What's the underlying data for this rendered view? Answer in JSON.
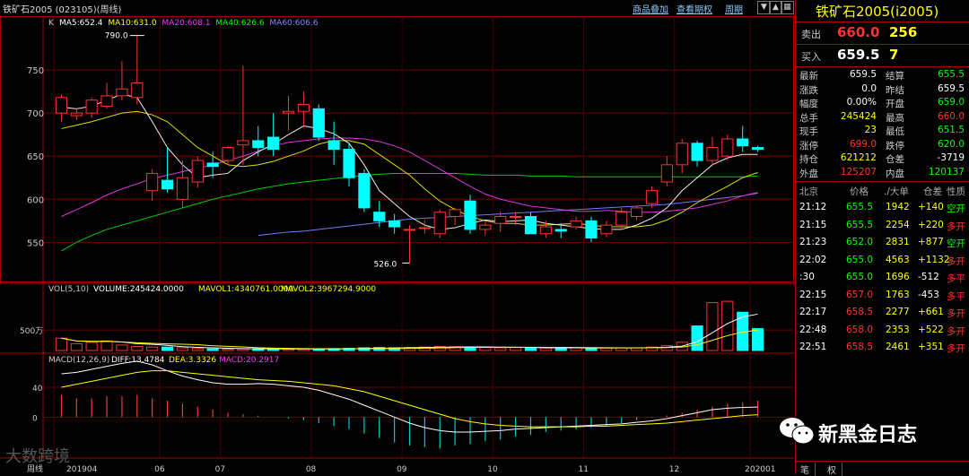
{
  "window": {
    "title": "铁矿石2005 (023105)(周线)",
    "buttons": [
      "商品叠加",
      "查看期权",
      "周期"
    ],
    "icons": [
      "down-arrow-icon",
      "up-arrow-icon",
      "grid-icon"
    ]
  },
  "main_legend": {
    "k": "K",
    "ma5": "MA5:652.4",
    "ma10": "MA10:631.0",
    "ma20": "MA20:608.1",
    "ma40": "MA40:626.6",
    "ma60": "MA60:606.6",
    "colors": {
      "ma5": "#ffffff",
      "ma10": "#ffff00",
      "ma20": "#ff33ff",
      "ma40": "#00ff00",
      "ma60": "#6666ff"
    }
  },
  "vol_legend": {
    "name": "VOL(5,10)",
    "volume": "VOLUME:245424.0000",
    "mavol1": "MAVOL1:4340761.0000",
    "mavol2": "MAVOL2:3967294.9000",
    "y_label": "500万"
  },
  "macd_legend": {
    "name": "MACD(12,26,9)",
    "diff": "DIFF:13.4784",
    "dea": "DEA:3.3326",
    "macd": "MACD:20.2917",
    "y_labels": [
      "40",
      "0"
    ]
  },
  "price_axis": [
    "750",
    "700",
    "650",
    "600",
    "550"
  ],
  "annotations": {
    "high": "790.0",
    "low": "526.0"
  },
  "x_axis": {
    "period_label": "周线",
    "labels": [
      "201904",
      "06",
      "07",
      "08",
      "09",
      "10",
      "11",
      "12",
      "202001"
    ]
  },
  "chart_data": {
    "type": "candlestick",
    "ylim": [
      515,
      800
    ],
    "candles": [
      [
        700,
        718,
        690,
        722
      ],
      [
        697,
        700,
        692,
        705
      ],
      [
        700,
        715,
        695,
        718
      ],
      [
        708,
        720,
        705,
        735
      ],
      [
        720,
        728,
        715,
        760
      ],
      [
        718,
        735,
        710,
        790
      ],
      [
        610,
        630,
        598,
        635
      ],
      [
        622,
        612,
        608,
        660
      ],
      [
        600,
        625,
        590,
        645
      ],
      [
        620,
        645,
        613,
        650
      ],
      [
        642,
        638,
        625,
        655
      ],
      [
        645,
        660,
        640,
        662
      ],
      [
        663,
        668,
        640,
        755
      ],
      [
        668,
        660,
        650,
        685
      ],
      [
        672,
        658,
        650,
        700
      ],
      [
        700,
        702,
        680,
        720
      ],
      [
        702,
        710,
        685,
        725
      ],
      [
        705,
        672,
        668,
        710
      ],
      [
        668,
        658,
        640,
        690
      ],
      [
        658,
        625,
        615,
        665
      ],
      [
        630,
        590,
        585,
        635
      ],
      [
        585,
        575,
        568,
        598
      ],
      [
        575,
        568,
        560,
        583
      ],
      [
        565,
        565,
        526,
        570
      ],
      [
        566,
        567,
        560,
        575
      ],
      [
        560,
        585,
        555,
        588
      ],
      [
        580,
        588,
        570,
        590
      ],
      [
        598,
        565,
        560,
        605
      ],
      [
        565,
        570,
        558,
        574
      ],
      [
        572,
        580,
        562,
        586
      ],
      [
        580,
        580,
        570,
        585
      ],
      [
        580,
        560,
        560,
        585
      ],
      [
        560,
        568,
        555,
        575
      ],
      [
        565,
        563,
        555,
        572
      ],
      [
        568,
        575,
        565,
        580
      ],
      [
        575,
        555,
        550,
        580
      ],
      [
        560,
        570,
        556,
        575
      ],
      [
        570,
        585,
        565,
        590
      ],
      [
        580,
        590,
        576,
        592
      ],
      [
        595,
        610,
        590,
        615
      ],
      [
        620,
        640,
        615,
        650
      ],
      [
        640,
        665,
        630,
        670
      ],
      [
        665,
        645,
        638,
        668
      ],
      [
        645,
        660,
        640,
        672
      ],
      [
        650,
        670,
        645,
        675
      ],
      [
        670,
        662,
        655,
        685
      ],
      [
        660,
        658,
        655,
        662
      ]
    ],
    "ma_series": {
      "ma5": [
        707,
        705,
        708,
        715,
        722,
        718,
        690,
        660,
        640,
        625,
        628,
        630,
        645,
        655,
        664,
        675,
        685,
        682,
        676,
        665,
        640,
        610,
        595,
        580,
        570,
        565,
        567,
        572,
        576,
        574,
        575,
        576,
        572,
        570,
        568,
        566,
        565,
        565,
        570,
        578,
        590,
        610,
        625,
        640,
        648,
        652,
        652
      ],
      "ma10": [
        682,
        686,
        690,
        695,
        700,
        702,
        698,
        690,
        675,
        660,
        650,
        640,
        638,
        640,
        644,
        650,
        656,
        664,
        668,
        668,
        664,
        652,
        640,
        628,
        612,
        598,
        588,
        580,
        575,
        572,
        572,
        570,
        570,
        571,
        572,
        570,
        568,
        568,
        568,
        570,
        576,
        585,
        596,
        606,
        615,
        625,
        631
      ],
      "ma20": [
        580,
        588,
        596,
        605,
        612,
        618,
        624,
        628,
        632,
        636,
        640,
        645,
        650,
        656,
        662,
        666,
        668,
        670,
        671,
        671,
        670,
        667,
        662,
        655,
        645,
        635,
        625,
        615,
        606,
        600,
        596,
        592,
        590,
        588,
        586,
        586,
        587,
        586,
        585,
        585,
        586,
        588,
        590,
        594,
        598,
        604,
        608
      ],
      "ma40": [
        null,
        null,
        null,
        null,
        null,
        null,
        null,
        null,
        null,
        null,
        null,
        null,
        null,
        null,
        null,
        null,
        null,
        null,
        null,
        null,
        null,
        null,
        null,
        null,
        null,
        null,
        null,
        null,
        null,
        null,
        null,
        null,
        null,
        null,
        null,
        null,
        null,
        null,
        null,
        null,
        null,
        null,
        null,
        null,
        null,
        null,
        null
      ],
      "ma40_line": [
        540,
        550,
        558,
        565,
        570,
        575,
        580,
        585,
        590,
        595,
        600,
        604,
        608,
        612,
        615,
        618,
        620,
        622,
        624,
        626,
        628,
        629,
        630,
        630,
        630,
        630,
        630,
        629,
        628,
        628,
        628,
        627,
        627,
        627,
        626,
        626,
        626,
        626,
        626,
        626,
        626,
        626,
        626,
        626,
        626,
        626,
        627
      ],
      "ma60_line": [
        null,
        null,
        null,
        null,
        null,
        null,
        null,
        null,
        null,
        null,
        null,
        null,
        null,
        558,
        560,
        562,
        563,
        565,
        567,
        569,
        571,
        573,
        575,
        577,
        578,
        579,
        580,
        581,
        582,
        583,
        584,
        585,
        586,
        587,
        588,
        589,
        590,
        591,
        592,
        593,
        594,
        596,
        598,
        600,
        602,
        604,
        607
      ]
    },
    "volume": [
      0.9,
      0.5,
      0.6,
      0.7,
      0.4,
      0.3,
      0.25,
      0.25,
      0.2,
      0.15,
      0.12,
      0.1,
      0.12,
      0.14,
      0.12,
      0.1,
      0.1,
      0.12,
      0.14,
      0.16,
      0.2,
      0.22,
      0.2,
      0.22,
      0.25,
      0.3,
      0.28,
      0.25,
      0.22,
      0.2,
      0.22,
      0.2,
      0.18,
      0.2,
      0.2,
      0.18,
      0.18,
      0.2,
      0.2,
      0.25,
      0.35,
      0.6,
      1.8,
      3.5,
      3.6,
      2.8,
      1.6,
      0.2
    ],
    "volume_max": 4.0,
    "macd_hist": [
      30,
      25,
      25,
      28,
      28,
      30,
      25,
      22,
      18,
      14,
      10,
      6,
      4,
      2,
      0,
      -2,
      -4,
      -8,
      -12,
      -16,
      -22,
      -28,
      -34,
      -38,
      -40,
      -42,
      -38,
      -36,
      -32,
      -30,
      -26,
      -24,
      -20,
      -18,
      -16,
      -14,
      -12,
      -8,
      -4,
      -1,
      2,
      6,
      10,
      14,
      18,
      20,
      22
    ],
    "macd_diff": [
      58,
      60,
      64,
      68,
      72,
      75,
      70,
      62,
      55,
      50,
      46,
      44,
      44,
      45,
      44,
      42,
      40,
      36,
      30,
      24,
      16,
      8,
      0,
      -8,
      -14,
      -18,
      -20,
      -20,
      -19,
      -18,
      -16,
      -15,
      -14,
      -13,
      -12,
      -11,
      -10,
      -9,
      -7,
      -5,
      -2,
      2,
      6,
      10,
      12,
      13,
      13.5
    ],
    "macd_dea": [
      40,
      44,
      48,
      52,
      56,
      60,
      62,
      62,
      60,
      58,
      56,
      54,
      52,
      50,
      49,
      48,
      46,
      44,
      42,
      38,
      34,
      28,
      22,
      16,
      10,
      4,
      -2,
      -6,
      -9,
      -11,
      -12,
      -13,
      -13,
      -13,
      -13,
      -12,
      -12,
      -11,
      -10,
      -9,
      -8,
      -6,
      -4,
      -2,
      0,
      2,
      3.3
    ],
    "macd_ylim": [
      -50,
      70
    ]
  },
  "quote": {
    "symbol": "铁矿石2005(i2005)",
    "sell": {
      "label": "卖出",
      "price": "660.0",
      "vol": "256"
    },
    "buy": {
      "label": "买入",
      "price": "659.5",
      "vol": "7"
    },
    "rows": [
      [
        "最新",
        "659.5",
        "结算",
        "655.5"
      ],
      [
        "涨跌",
        "0.0",
        "昨结",
        "659.5"
      ],
      [
        "幅度",
        "0.00%",
        "开盘",
        "659.0"
      ],
      [
        "总手",
        "245424",
        "最高",
        "660.0"
      ],
      [
        "现手",
        "23",
        "最低",
        "651.5"
      ],
      [
        "涨停",
        "699.0",
        "跌停",
        "620.0"
      ],
      [
        "持仓",
        "621212",
        "仓差",
        "-3719"
      ],
      [
        "外盘",
        "125207",
        "内盘",
        "120137"
      ]
    ],
    "tick_header": [
      "北京",
      "价格",
      "./大单",
      "仓差",
      "性质"
    ],
    "ticks": [
      [
        "21:12",
        "655.5",
        "1942",
        "+140",
        "空开"
      ],
      [
        "21:15",
        "655.5",
        "2254",
        "+220",
        "多开"
      ],
      [
        "21:23",
        "652.0",
        "2831",
        "+877",
        "空开"
      ],
      [
        "22:02",
        "655.0",
        "4563",
        "+1132",
        "多开"
      ],
      [
        ":30",
        "655.0",
        "1696",
        "-512",
        "多平"
      ],
      [
        "22:15",
        "657.0",
        "1763",
        "-453",
        "多平"
      ],
      [
        "22:17",
        "658.5",
        "2277",
        "+661",
        "多开"
      ],
      [
        "22:48",
        "658.0",
        "2353",
        "+522",
        "多开"
      ],
      [
        "22:51",
        "658.5",
        "2461",
        "+351",
        "多开"
      ]
    ],
    "bottom_tabs": [
      "笔",
      "权"
    ]
  },
  "watermarks": {
    "wechat": "新黑金日志",
    "bl_logo": "大数跨境"
  }
}
